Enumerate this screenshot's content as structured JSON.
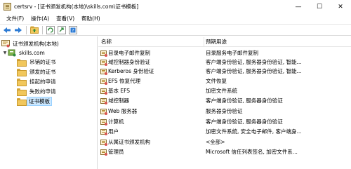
{
  "window": {
    "title": "certsrv - [证书颁发机构(本地)\\skills.com\\证书模板]",
    "minimize": "—",
    "maximize": "☐",
    "close": "✕"
  },
  "menu": [
    "文件(F)",
    "操作(A)",
    "查看(V)",
    "帮助(H)"
  ],
  "toolbar": {
    "icons": [
      "back-arrow-icon",
      "forward-arrow-icon",
      "up-folder-icon",
      "refresh-icon",
      "export-icon",
      "help-icon"
    ]
  },
  "tree": {
    "root": "证书颁发机构(本地)",
    "ca": "skills.com",
    "items": [
      "吊销的证书",
      "颁发的证书",
      "挂起的申请",
      "失败的申请",
      "证书模板"
    ],
    "selected_index": 4
  },
  "list": {
    "columns": [
      "名称",
      "预期用途"
    ],
    "rows": [
      {
        "name": "目录电子邮件复制",
        "purpose": "目录服务电子邮件复制"
      },
      {
        "name": "域控制器身份验证",
        "purpose": "客户端身份验证, 服务器身份验证, 智能..."
      },
      {
        "name": "Kerberos 身份验证",
        "purpose": "客户端身份验证, 服务器身份验证, 智能..."
      },
      {
        "name": "EFS 恢复代理",
        "purpose": "文件恢复"
      },
      {
        "name": "基本 EFS",
        "purpose": "加密文件系统"
      },
      {
        "name": "域控制器",
        "purpose": "客户端身份验证, 服务器身份验证"
      },
      {
        "name": "Web 服务器",
        "purpose": "服务器身份验证"
      },
      {
        "name": "计算机",
        "purpose": "客户端身份验证, 服务器身份验证"
      },
      {
        "name": "用户",
        "purpose": "加密文件系统, 安全电子邮件, 客户端身..."
      },
      {
        "name": "从属证书颁发机构",
        "purpose": "<全部>"
      },
      {
        "name": "管理员",
        "purpose": "Microsoft 信任列表签名, 加密文件系..."
      }
    ]
  }
}
